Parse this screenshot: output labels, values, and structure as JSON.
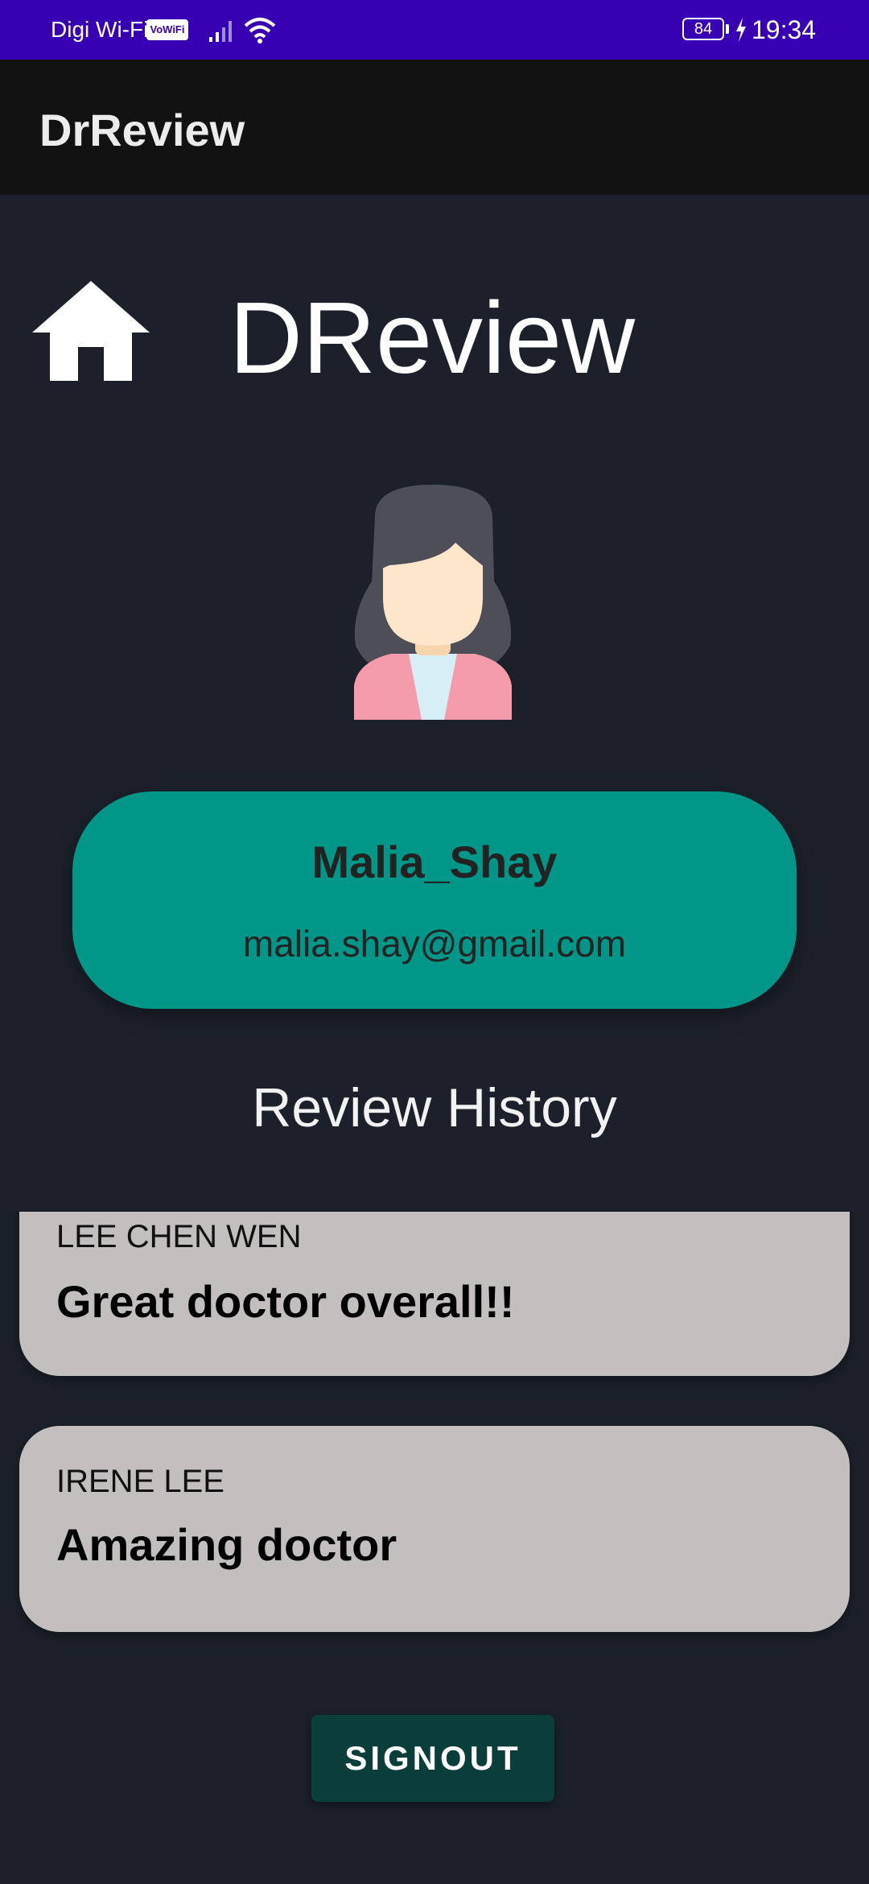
{
  "status_bar": {
    "carrier": "Digi Wi-Fi",
    "vowifi": "VoWiFi",
    "battery": "84",
    "time": "19:34"
  },
  "app_bar": {
    "title": "DrReview"
  },
  "header": {
    "brand": "DReview",
    "home_icon": "home-icon"
  },
  "profile": {
    "avatar_icon": "female-user-avatar",
    "username": "Malia_Shay",
    "email": "malia.shay@gmail.com"
  },
  "reviews": {
    "title": "Review History",
    "items": [
      {
        "doctor": "LEE CHEN WEN",
        "comment": "Great doctor overall!!"
      },
      {
        "doctor": "IRENE LEE",
        "comment": "Amazing doctor"
      }
    ]
  },
  "signout": {
    "label": "SIGNOUT"
  },
  "colors": {
    "status_bar": "#3700b3",
    "app_bar": "#121212",
    "background": "#1b202a",
    "profile_card": "#009688",
    "review_card": "#c3bfbe",
    "signout_button": "#0b3d3a"
  }
}
